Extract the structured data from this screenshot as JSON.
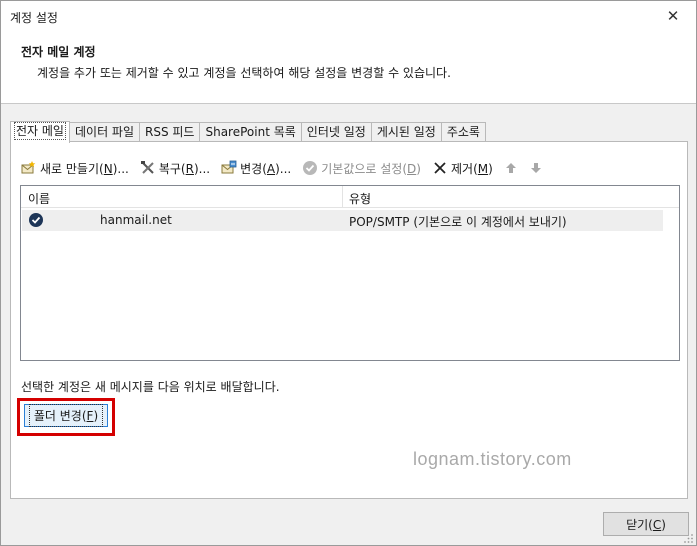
{
  "window": {
    "title": "계정 설정",
    "close_glyph": "✕"
  },
  "header": {
    "title": "전자 메일 계정",
    "description": "계정을 추가 또는 제거할 수 있고 계정을 선택하여 해당 설정을 변경할 수 있습니다."
  },
  "tabs": [
    {
      "label": "전자 메일"
    },
    {
      "label": "데이터 파일"
    },
    {
      "label": "RSS 피드"
    },
    {
      "label": "SharePoint 목록"
    },
    {
      "label": "인터넷 일정"
    },
    {
      "label": "게시된 일정"
    },
    {
      "label": "주소록"
    }
  ],
  "toolbar": {
    "new": {
      "label": "새로 만들기",
      "key": "N",
      "suffix": "...",
      "icon": "new-account-icon"
    },
    "repair": {
      "label": "복구",
      "key": "R",
      "suffix": "...",
      "icon": "repair-tools-icon"
    },
    "change": {
      "label": "변경",
      "key": "A",
      "suffix": "...",
      "icon": "change-account-icon"
    },
    "default": {
      "label": "기본값으로 설정",
      "key": "D",
      "suffix": "",
      "icon": "check-circle-icon"
    },
    "remove": {
      "label": "제거",
      "key": "M",
      "suffix": "",
      "icon": "remove-x-icon"
    },
    "up_icon": "arrow-up-icon",
    "down_icon": "arrow-down-icon"
  },
  "list": {
    "columns": {
      "name": "이름",
      "type": "유형"
    },
    "rows": [
      {
        "name": "hanmail.net",
        "type": "POP/SMTP (기본으로 이 계정에서 보내기)"
      }
    ]
  },
  "delivery": {
    "text": "선택한 계정은 새 메시지를 다음 위치로 배달합니다.",
    "button_label": "폴더 변경",
    "button_key": "F"
  },
  "watermark": "lognam.tistory.com",
  "footer": {
    "close_label": "닫기",
    "close_key": "C"
  },
  "colors": {
    "highlight": "#d40000",
    "focus_border": "#2b7fd6",
    "disabled_text": "#8c8c8c"
  }
}
